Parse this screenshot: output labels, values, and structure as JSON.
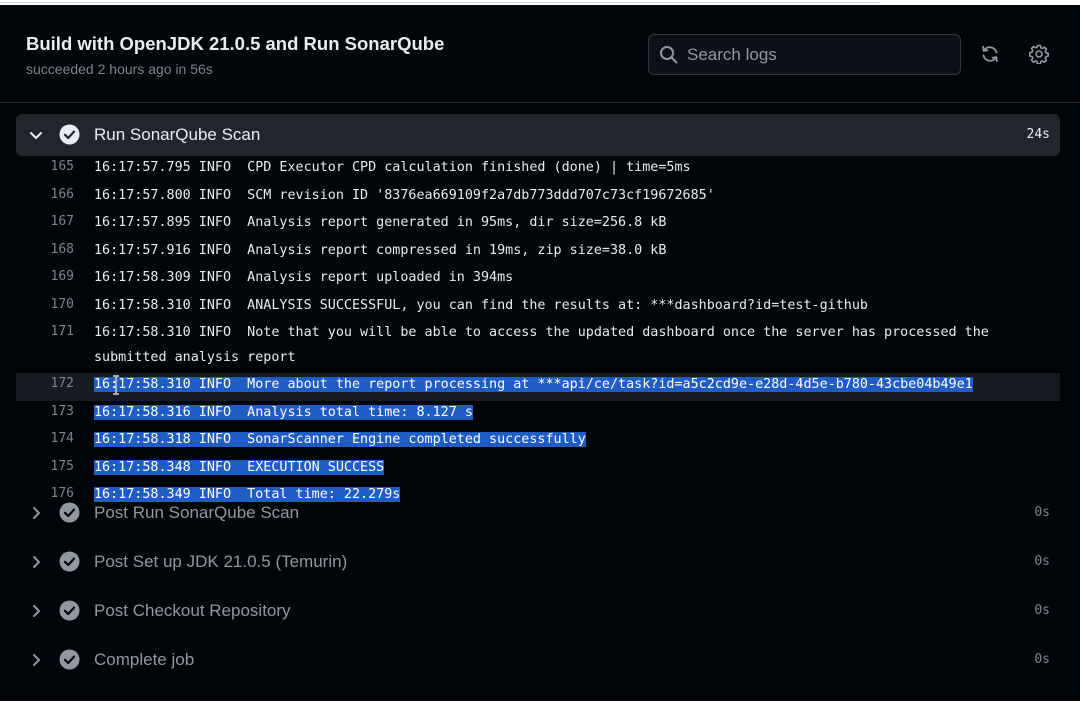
{
  "job": {
    "title": "Build with OpenJDK 21.0.5 and Run SonarQube",
    "status": "succeeded 2 hours ago in 56s"
  },
  "search": {
    "placeholder": "Search logs"
  },
  "icons": {
    "search": "search-icon",
    "refresh": "refresh-icon",
    "settings": "gear-icon",
    "expand": "chevron-down-icon",
    "collapse": "chevron-right-icon",
    "success": "check-circle-icon"
  },
  "colors": {
    "selection": "#1f5cc4",
    "success": "#e6edf3"
  },
  "expanded_step": {
    "name": "Run SonarQube Scan",
    "duration": "24s"
  },
  "log_lines": [
    {
      "num": "165",
      "text": "16:17:57.795 INFO  CPD Executor CPD calculation finished (done) | time=5ms",
      "selected": false
    },
    {
      "num": "166",
      "text": "16:17:57.800 INFO  SCM revision ID '8376ea669109f2a7db773ddd707c73cf19672685'",
      "selected": false
    },
    {
      "num": "167",
      "text": "16:17:57.895 INFO  Analysis report generated in 95ms, dir size=256.8 kB",
      "selected": false
    },
    {
      "num": "168",
      "text": "16:17:57.916 INFO  Analysis report compressed in 19ms, zip size=38.0 kB",
      "selected": false
    },
    {
      "num": "169",
      "text": "16:17:58.309 INFO  Analysis report uploaded in 394ms",
      "selected": false
    },
    {
      "num": "170",
      "text": "16:17:58.310 INFO  ANALYSIS SUCCESSFUL, you can find the results at: ***dashboard?id=test-github",
      "selected": false
    },
    {
      "num": "171",
      "text": "16:17:58.310 INFO  Note that you will be able to access the updated dashboard once the server has processed the submitted analysis report",
      "selected": false
    },
    {
      "num": "172",
      "text": "16:17:58.310 INFO  More about the report processing at ***api/ce/task?id=a5c2cd9e-e28d-4d5e-b780-43cbe04b49e1",
      "selected": true,
      "current": true
    },
    {
      "num": "173",
      "text": "16:17:58.316 INFO  Analysis total time: 8.127 s",
      "selected": true
    },
    {
      "num": "174",
      "text": "16:17:58.318 INFO  SonarScanner Engine completed successfully",
      "selected": true
    },
    {
      "num": "175",
      "text": "16:17:58.348 INFO  EXECUTION SUCCESS",
      "selected": true
    },
    {
      "num": "176",
      "text": "16:17:58.349 INFO  Total time: 22.279s",
      "selected": true
    }
  ],
  "collapsed_steps": [
    {
      "name": "Post Run SonarQube Scan",
      "duration": "0s"
    },
    {
      "name": "Post Set up JDK 21.0.5 (Temurin)",
      "duration": "0s"
    },
    {
      "name": "Post Checkout Repository",
      "duration": "0s"
    },
    {
      "name": "Complete job",
      "duration": "0s"
    }
  ]
}
